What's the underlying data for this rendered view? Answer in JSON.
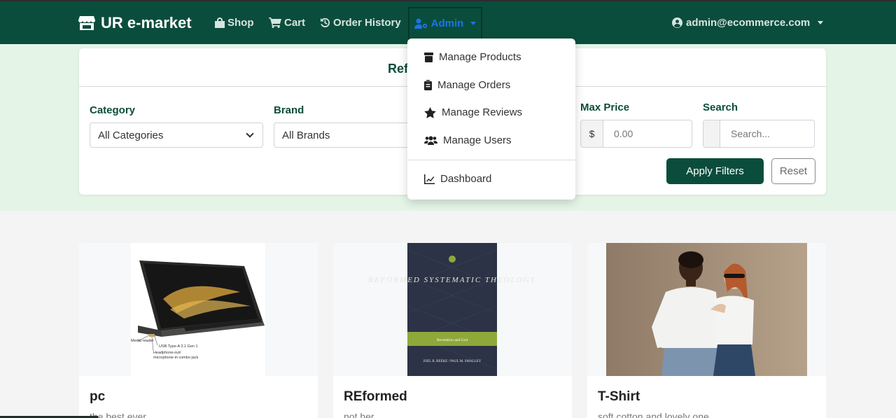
{
  "navbar": {
    "brand": "UR e-market",
    "links": [
      "Shop",
      "Cart",
      "Order History"
    ],
    "admin_label": "Admin",
    "user_email": "admin@ecommerce.com",
    "bg_color": "#0b4d3c",
    "active_color": "#1a74e8"
  },
  "admin_menu": {
    "items": [
      "Manage Products",
      "Manage Orders",
      "Manage Reviews",
      "Manage Users"
    ],
    "dashboard": "Dashboard"
  },
  "filters": {
    "title": "Ref",
    "category_label": "Category",
    "category_value": "All Categories",
    "brand_label": "Brand",
    "brand_value": "All Brands",
    "max_price_label": "Max Price",
    "currency": "$",
    "max_price_placeholder": "0.00",
    "search_label": "Search",
    "search_placeholder": "Search...",
    "apply_label": "Apply Filters",
    "reset_label": "Reset"
  },
  "products": [
    {
      "title": "pc",
      "description": "the best ever",
      "image": "laptop-photo",
      "image_captions": [
        "Media reader",
        "USB Type-A 3.1 Gen 1",
        "Headphone-out/",
        "microphone-in combo jack"
      ]
    },
    {
      "title": "REformed",
      "description": "not her",
      "image": "book-cover-photo",
      "book_title": "REFORMED SYSTEMATIC THEOLOGY",
      "book_subtitle": "Revelation and God",
      "book_authors": "JOEL R. BEEKE / PAUL M. SMALLEY"
    },
    {
      "title": "T-Shirt",
      "description": "soft cotton and lovely one",
      "image": "models-tshirt-photo"
    }
  ]
}
